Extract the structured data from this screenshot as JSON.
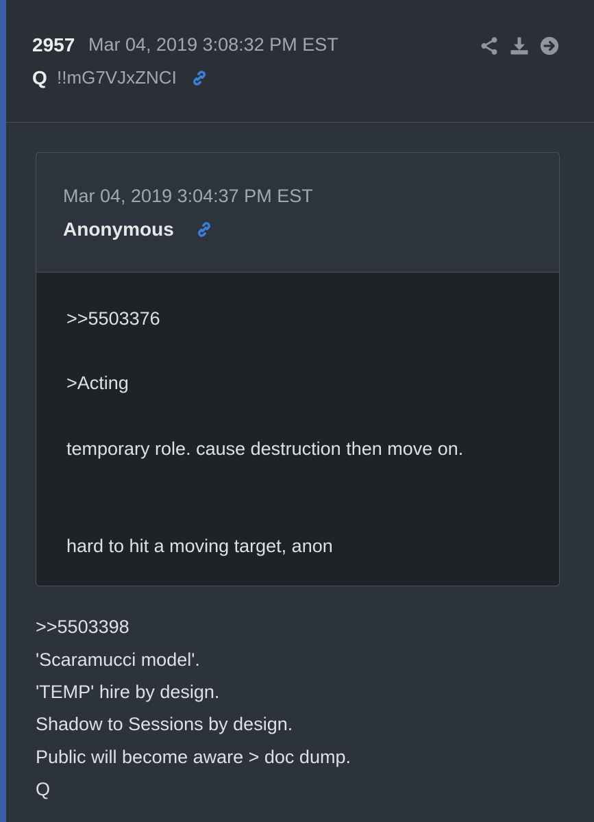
{
  "post": {
    "number": "2957",
    "date": "Mar 04, 2019 3:08:32 PM EST",
    "author": "Q",
    "tripcode": "!!mG7VJxZNCI"
  },
  "header_icons": [
    "share-icon",
    "download-icon",
    "arrow-right-circle-icon"
  ],
  "colors": {
    "accent": "#3b5fa6",
    "link": "#3e7fd6",
    "background": "#2d333d",
    "quote_body": "#1f2227"
  },
  "quoted_post": {
    "date": "Mar 04, 2019 3:04:37 PM EST",
    "author": "Anonymous",
    "lines": [
      ">>5503376",
      ">Acting",
      "temporary role. cause destruction then move on.",
      "hard to hit a moving target, anon"
    ]
  },
  "reply": {
    "lines": [
      ">>5503398",
      "'Scaramucci model'.",
      "'TEMP' hire by design.",
      "Shadow to Sessions by design.",
      "Public will become aware > doc dump.",
      "Q"
    ]
  }
}
